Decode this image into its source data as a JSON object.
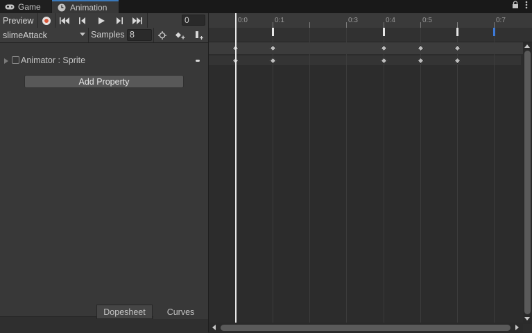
{
  "tabs": [
    {
      "label": "Game",
      "icon": "gamepad-icon"
    },
    {
      "label": "Animation",
      "icon": "clock-icon"
    }
  ],
  "toolbar": {
    "preview_label": "Preview",
    "frame_value": "0",
    "record_color": "#d9573a"
  },
  "clip": {
    "selected": "slimeAttack",
    "samples_label": "Samples",
    "samples_value": "8"
  },
  "property": {
    "label": "Animator : Sprite"
  },
  "add_property_label": "Add Property",
  "bottom_tabs": {
    "dopesheet": "Dopesheet",
    "curves": "Curves"
  },
  "ruler": {
    "labels": [
      "0:0",
      "0:1",
      "0:3",
      "0:4",
      "0:5",
      "0:7"
    ]
  },
  "colors": {
    "accent": "#3a79bb",
    "event_selected": "#3d7ad8"
  }
}
